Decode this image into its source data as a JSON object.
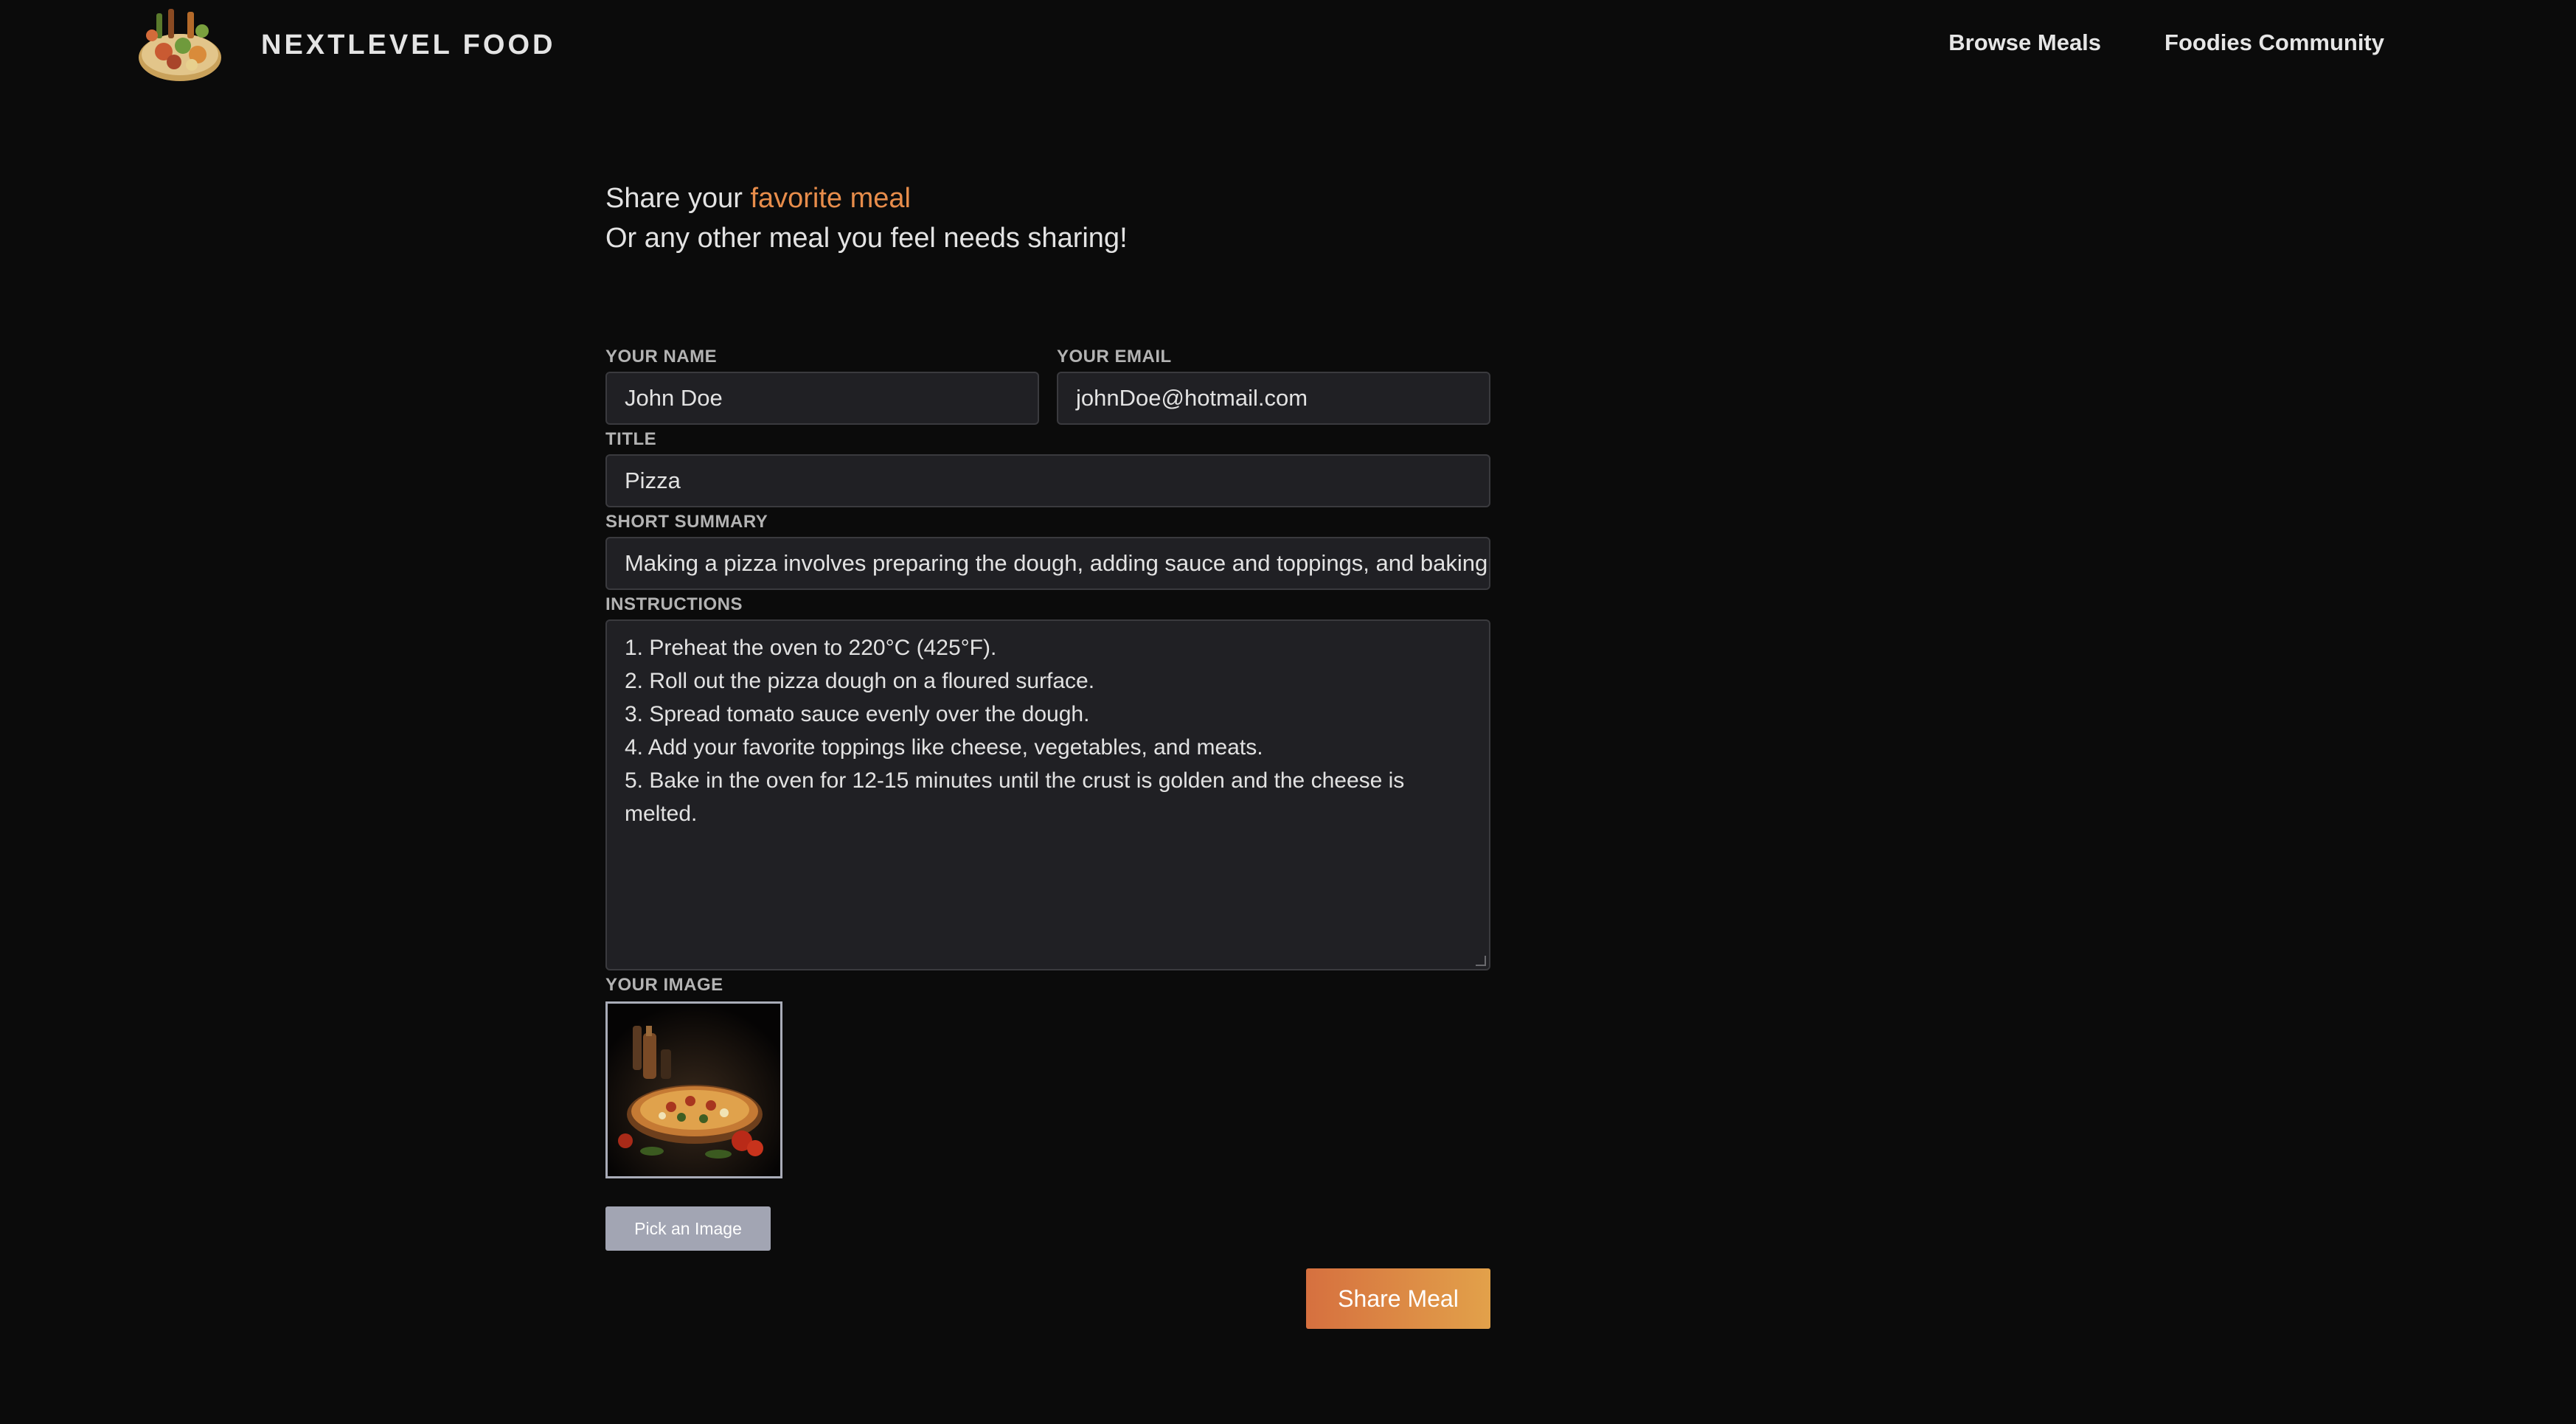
{
  "header": {
    "brand_name": "NEXTLEVEL FOOD",
    "nav": [
      {
        "label": "Browse Meals"
      },
      {
        "label": "Foodies Community"
      }
    ]
  },
  "hero": {
    "line1_prefix": "Share your ",
    "line1_highlight": "favorite meal",
    "line2": "Or any other meal you feel needs sharing!"
  },
  "form": {
    "name": {
      "label": "YOUR NAME",
      "value": "John Doe"
    },
    "email": {
      "label": "YOUR EMAIL",
      "value": "johnDoe@hotmail.com"
    },
    "title": {
      "label": "TITLE",
      "value": "Pizza"
    },
    "summary": {
      "label": "SHORT SUMMARY",
      "value": "Making a pizza involves preparing the dough, adding sauce and toppings, and baking it"
    },
    "instructions": {
      "label": "INSTRUCTIONS",
      "lines": [
        "1. Preheat the oven to 220°C (425°F).",
        "2. Roll out the pizza dough on a floured surface.",
        "3. Spread tomato sauce evenly over the dough.",
        "4. Add your favorite toppings like cheese, vegetables, and meats.",
        "5. Bake in the oven for 12-15 minutes until the crust is golden and the cheese is",
        "melted."
      ]
    },
    "image": {
      "label": "YOUR IMAGE",
      "pick_label": "Pick an Image"
    },
    "submit_label": "Share Meal"
  },
  "colors": {
    "background": "#0b0b0b",
    "accent": "#e88d4b",
    "button_gradient_start": "#d6703f",
    "button_gradient_end": "#e2a14a",
    "field_background": "#202024"
  },
  "icons": {
    "logo": "food-platter-logo",
    "preview": "pizza-photo"
  }
}
